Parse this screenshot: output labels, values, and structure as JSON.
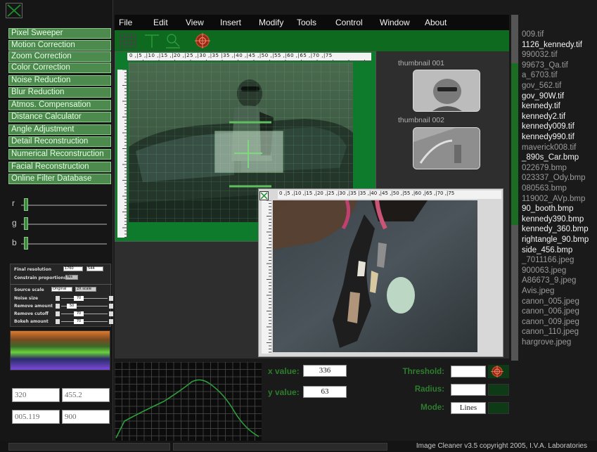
{
  "filters": [
    "Pixel Sweeper",
    "Motion Correction",
    "Zoom Correction",
    "Color Correction",
    "Noise Reduction",
    "Blur Reduction",
    "Atmos. Compensation",
    "Distance Calculator",
    "Angle Adjustment",
    "Detail Reconstruction",
    "Numerical Reconstruction",
    "Facial Reconstruction",
    "Online Filter Database"
  ],
  "rgb": {
    "r_label": "r",
    "g_label": "g",
    "b_label": "b"
  },
  "params": {
    "final_resolution_label": "Final resolution",
    "final_resolution_w": "1760",
    "final_resolution_h": "544",
    "constrain_label": "Constrain proportions",
    "constrain_value": "Yes",
    "source_scale_label": "Source scale",
    "source_scale_option_a": "Original",
    "source_scale_option_b": "2X scale",
    "noise_size_label": "Noise size",
    "noise_size_value": "70",
    "remove_amount_label": "Remove amount",
    "remove_amount_value": "50",
    "remove_cutoff_label": "Remove cutoff",
    "remove_cutoff_value": "70",
    "bokeh_amount_label": "Bokeh amount",
    "bokeh_amount_value": "70"
  },
  "coords": {
    "a": "320",
    "b": "455.2",
    "c": "005.119",
    "d": "900"
  },
  "menu": [
    "File",
    "Edit",
    "View",
    "Insert",
    "Modify",
    "Tools",
    "Control",
    "Window",
    "About"
  ],
  "thumbnails": [
    {
      "label": "thumbnail 001"
    },
    {
      "label": "thumbnail 002"
    }
  ],
  "ruler_marks": "0 ,|5 ,|10 ,|15 ,|20 ,|25 ,|30 ,|35 |35 ,|40 ,|45 ,|50 ,|55 ,|60 ,|65 ,|70 ,|75",
  "files": [
    {
      "name": "009.tif",
      "bright": false
    },
    {
      "name": "1126_kennedy.tif",
      "bright": true
    },
    {
      "name": "990032.tif",
      "bright": false
    },
    {
      "name": "99673_Qa.tif",
      "bright": false
    },
    {
      "name": "a_6703.tif",
      "bright": false
    },
    {
      "name": "gov_562.tif",
      "bright": false
    },
    {
      "name": "gov_90W.tif",
      "bright": true
    },
    {
      "name": "kennedy.tif",
      "bright": true
    },
    {
      "name": "kennedy2.tif",
      "bright": true
    },
    {
      "name": "kennedy009.tif",
      "bright": true
    },
    {
      "name": "kennedy990.tif",
      "bright": true
    },
    {
      "name": "maverick008.tif",
      "bright": false
    },
    {
      "name": "_890s_Car.bmp",
      "bright": true
    },
    {
      "name": "022679.bmp",
      "bright": false
    },
    {
      "name": "023337_Ody.bmp",
      "bright": false
    },
    {
      "name": "080563.bmp",
      "bright": false
    },
    {
      "name": "119002_AVp.bmp",
      "bright": false
    },
    {
      "name": "90_booth.bmp",
      "bright": true
    },
    {
      "name": "kennedy390.bmp",
      "bright": true
    },
    {
      "name": "kennedy_360.bmp",
      "bright": true
    },
    {
      "name": "rightangle_90.bmp",
      "bright": true
    },
    {
      "name": "side_456.bmp",
      "bright": true
    },
    {
      "name": "_7011166.jpeg",
      "bright": false
    },
    {
      "name": "900063.jpeg",
      "bright": false
    },
    {
      "name": "A86673_9.jpeg",
      "bright": false
    },
    {
      "name": "Avis.jpeg",
      "bright": false
    },
    {
      "name": "canon_005.jpeg",
      "bright": false
    },
    {
      "name": "canon_006.jpeg",
      "bright": false
    },
    {
      "name": "canon_009.jpeg",
      "bright": false
    },
    {
      "name": "canon_110.jpeg",
      "bright": false
    },
    {
      "name": "hargrove.jpeg",
      "bright": false
    }
  ],
  "values": {
    "x_label": "x value:",
    "x_value": "336",
    "y_label": "y value:",
    "y_value": "63"
  },
  "controls": {
    "threshold_label": "Threshold:",
    "threshold_value": "",
    "radius_label": "Radius:",
    "radius_value": "",
    "mode_label": "Mode:",
    "mode_value": "Lines"
  },
  "status": {
    "text": "Image Cleaner v3.5   copyright 2005, I.V.A. Laboratories"
  },
  "colors": {
    "accent_green": "#0d6a1f",
    "button_green": "#4d8a4d",
    "label_green": "#2d7d2d"
  }
}
